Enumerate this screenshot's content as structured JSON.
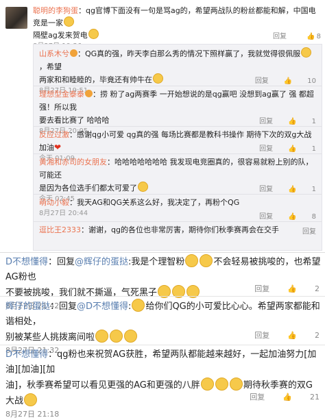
{
  "main_comment": {
    "user": "聪明的李狗蛋",
    "text1": "：qg官博下面没有一句是骂ag的，希望两战队的粉丝都能和解，中国电竞是一家",
    "text2": "隔壁ag发来贺电",
    "time": "8月27日 19:36",
    "reply": "回复",
    "likes": "8"
  },
  "replies": [
    {
      "user": "山系木兮",
      "text1": "：QG真的强，昨天李白那么秀的情况下照样赢了，我就觉得很佩服",
      "text1b": "，希望",
      "text2": "两家和和睦睦的，毕竟还有帅牛在",
      "time": "8月27日 19:51",
      "reply": "回复",
      "likes": "10"
    },
    {
      "user": "理想型金泰泰",
      "text1": "：捞 粉了ag两赛季 一开始想说的是qg赢吧 没想到ag赢了 强 都超强！所以我",
      "text2": "要去看比赛了 哈哈哈",
      "time": "8月27日 20:05",
      "reply": "回复",
      "likes": "1"
    },
    {
      "user": "反应过激",
      "text1": "：感谢qg小可爱 qg真的强 每场比赛都是教科书操作 期待下次的双g大战 加油",
      "time": "今天 01:09",
      "reply": "回复",
      "likes": "1"
    },
    {
      "user": "黄湘和赤司的女朋友",
      "text1": "：哈哈哈哈哈哈哈 我发现电竞圈真的，很容易就粉上别的队，可能还",
      "text2": "是因为各位选手们都太可爱了",
      "time": "今天 02:45",
      "reply": "回复",
      "likes": "1"
    },
    {
      "user": "萌动小毅",
      "text1": "：我天AG和QG关系这么好，我决定了，再粉个QG",
      "time": "8月27日 20:44",
      "reply": "回复",
      "likes": "8"
    },
    {
      "user": "逗比王2333",
      "text1": "：谢谢，qg的各位也非常厉害，期待你们秋季赛再会",
      "text2": "在交手",
      "reply": "回复"
    }
  ],
  "bottom_comments": [
    {
      "user": "D不想懂得",
      "text1": "：回复",
      "mention": "@辉仔的蛋挞",
      "text1b": ":我是个理智粉",
      "text1c": "不会轻易被挑唆的，也希望AG粉也",
      "text2": "不要被挑唆，我们就不撕逼，气死黑子",
      "time": "8月27日 21:42",
      "reply": "回复",
      "likes": "2"
    },
    {
      "user": "辉仔的蛋挞",
      "text1": "：回复",
      "mention": "@D不想懂得",
      "text1b": ":",
      "text1c": "给你们QG的小可爱比心心。希望两家都能和谐相处，",
      "text2": "别被某些人挑拨离间啦",
      "time": "8月27日 21:32",
      "reply": "回复",
      "likes": "2"
    },
    {
      "user": "D不想懂得",
      "text1": "：qg粉也来祝贺AG获胜，希望两队都能越来越好，一起加油努力[加油][加油][加",
      "text2": "油]，秋季赛希望可以看见更强的AG和更强的八胖",
      "text2b": "期待秋季赛的双G大战",
      "time": "8月27日 21:18",
      "reply": "回复",
      "likes": "21"
    }
  ]
}
